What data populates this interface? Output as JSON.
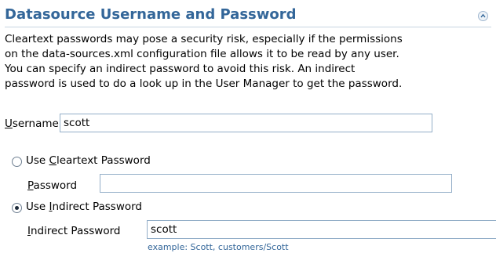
{
  "section": {
    "title": "Datasource Username and Password"
  },
  "description": {
    "lines": [
      "Cleartext passwords may pose a security risk, especially if the permissions",
      "on the data-sources.xml configuration file allows it to be read by any user.",
      "You can specify an indirect password to avoid this risk. An indirect",
      "password is used to do a look up in the User Manager to get the password."
    ]
  },
  "username": {
    "label_access_key": "U",
    "label_rest": "sername",
    "value": "scott"
  },
  "cleartext_option": {
    "label_prefix": "Use ",
    "label_access_key": "C",
    "label_rest": "leartext Password",
    "selected": false
  },
  "password": {
    "label_access_key": "P",
    "label_rest": "assword",
    "value": ""
  },
  "indirect_option": {
    "label_prefix": "Use ",
    "label_access_key": "I",
    "label_rest": "ndirect Password",
    "selected": true
  },
  "indirect_password": {
    "label_access_key": "I",
    "label_rest": "ndirect Password",
    "value": "scott",
    "hint": "example: Scott, customers/Scott"
  },
  "colors": {
    "header_text": "#336699",
    "hint_text": "#336699",
    "input_border": "#93aec8"
  }
}
